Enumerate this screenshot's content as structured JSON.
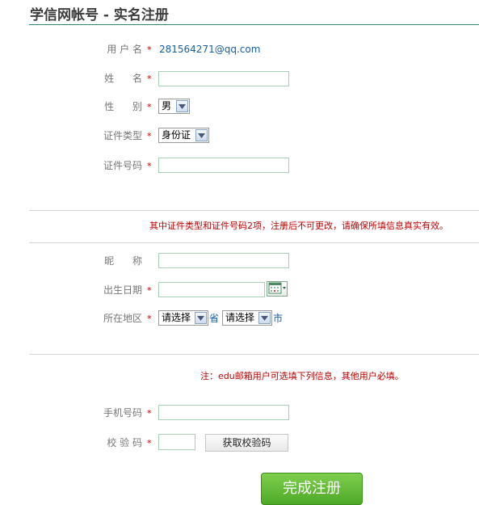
{
  "header": {
    "title": "学信网帐号 - 实名注册"
  },
  "form1": {
    "username": {
      "label": "用 户 名",
      "value": "281564271@qq.com"
    },
    "name": {
      "label": "姓      名",
      "value": ""
    },
    "gender": {
      "label": "性      别",
      "selected": "男"
    },
    "id_type": {
      "label": "证件类型",
      "selected": "身份证"
    },
    "id_number": {
      "label": "证件号码",
      "value": ""
    }
  },
  "notice1": "其中证件类型和证件号码2项，注册后不可更改，请确保所填信息真实有效。",
  "form2": {
    "nickname": {
      "label": "昵      称",
      "value": ""
    },
    "birthdate": {
      "label": "出生日期",
      "value": ""
    },
    "region": {
      "label": "所在地区",
      "province_selected": "请选择",
      "province_unit": "省",
      "city_selected": "请选择",
      "city_unit": "市"
    }
  },
  "notice2": "注：edu邮箱用户可选填下列信息，其他用户必填。",
  "form3": {
    "phone": {
      "label": "手机号码",
      "value": ""
    },
    "code": {
      "label": "校 验 码",
      "value": "",
      "button": "获取校验码"
    }
  },
  "required_mark": "*",
  "submit_label": "完成注册"
}
